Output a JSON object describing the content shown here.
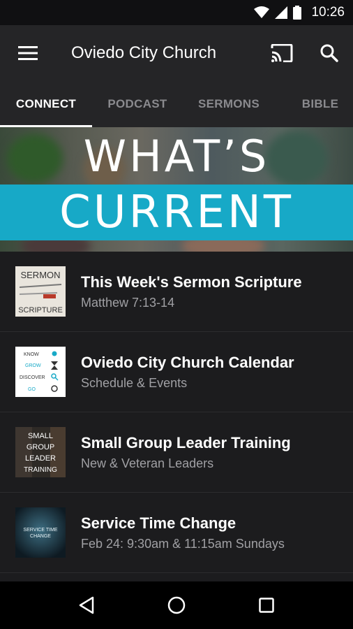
{
  "status": {
    "time": "10:26"
  },
  "app_bar": {
    "title": "Oviedo City Church"
  },
  "tabs": [
    {
      "label": "CONNECT"
    },
    {
      "label": "PODCAST"
    },
    {
      "label": "SERMONS"
    },
    {
      "label": "BIBLE"
    }
  ],
  "banner": {
    "line1": "WHAT’S",
    "line2": "CURRENT"
  },
  "items": [
    {
      "title": "This Week's Sermon Scripture",
      "subtitle": "Matthew 7:13-14"
    },
    {
      "title": "Oviedo City Church Calendar",
      "subtitle": "Schedule & Events"
    },
    {
      "title": "Small Group Leader Training",
      "subtitle": "New & Veteran Leaders"
    },
    {
      "title": "Service Time Change",
      "subtitle": "Feb 24: 9:30am & 11:15am Sundays"
    }
  ],
  "thumbs": {
    "sermon": {
      "line1": "SERMON",
      "line2": "SCRIPTURE"
    },
    "calendar": {
      "l1": "KNOW",
      "l2": "GROW",
      "l3": "DISCOVER",
      "l4": "GO"
    },
    "group": {
      "l1": "SMALL",
      "l2": "GROUP",
      "l3": "LEADER",
      "l4": "TRAINING"
    },
    "service": {
      "l1": "SERVICE TIME",
      "l2": "CHANGE"
    }
  },
  "colors": {
    "accent": "#17a9c7",
    "appbar": "#252527",
    "background": "#1c1c1e"
  }
}
